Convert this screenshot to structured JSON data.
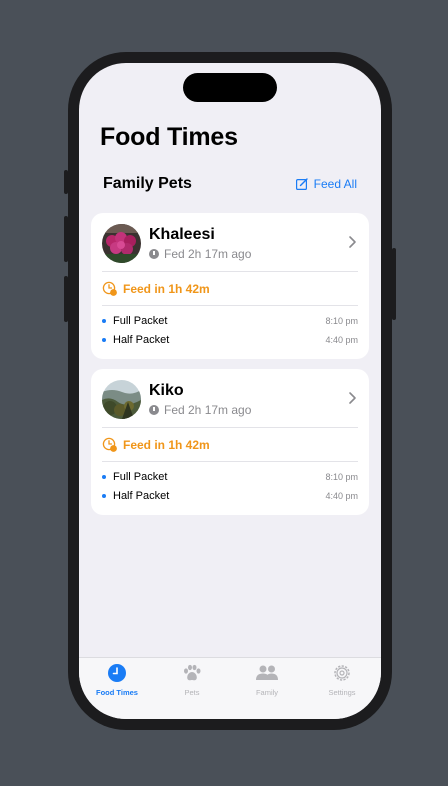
{
  "app": {
    "title": "Food Times"
  },
  "section": {
    "title": "Family Pets",
    "feed_all_label": "Feed All"
  },
  "pets": [
    {
      "name": "Khaleesi",
      "fed_text": "Fed 2h 17m ago",
      "feed_in_text": "Feed in 1h 42m",
      "meals": [
        {
          "name": "Full Packet",
          "time": "8:10 pm"
        },
        {
          "name": "Half Packet",
          "time": "4:40 pm"
        }
      ]
    },
    {
      "name": "Kiko",
      "fed_text": "Fed 2h 17m ago",
      "feed_in_text": "Feed in 1h 42m",
      "meals": [
        {
          "name": "Full Packet",
          "time": "8:10 pm"
        },
        {
          "name": "Half Packet",
          "time": "4:40 pm"
        }
      ]
    }
  ],
  "tabs": [
    {
      "label": "Food Times",
      "icon": "clock-icon",
      "active": true
    },
    {
      "label": "Pets",
      "icon": "paw-icon",
      "active": false
    },
    {
      "label": "Family",
      "icon": "people-icon",
      "active": false
    },
    {
      "label": "Settings",
      "icon": "gear-icon",
      "active": false
    }
  ],
  "colors": {
    "accent": "#1a7cf5",
    "warning": "#f0961a",
    "background": "#f0eff5"
  }
}
